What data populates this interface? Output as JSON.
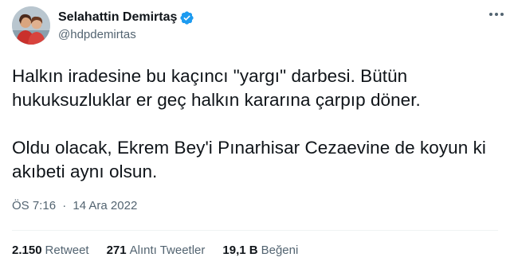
{
  "author": {
    "display_name": "Selahattin Demirtaş",
    "handle": "@hdpdemirtas",
    "verified": true
  },
  "tweet": {
    "paragraphs": [
      "Halkın iradesine bu kaçıncı \"yargı\" darbesi. Bütün hukuksuzluklar er geç halkın kararına çarpıp döner.",
      "Oldu olacak, Ekrem Bey'i Pınarhisar Cezaevine de koyun ki akıbeti aynı olsun."
    ],
    "time": "ÖS 7:16",
    "separator": "·",
    "date": "14 Ara 2022"
  },
  "stats": {
    "retweets_count": "2.150",
    "retweets_label": "Retweet",
    "quotes_count": "271",
    "quotes_label": "Alıntı Tweetler",
    "likes_count": "19,1 B",
    "likes_label": "Beğeni"
  },
  "colors": {
    "text": "#0f1419",
    "secondary": "#536471",
    "verified_badge": "#1d9bf0",
    "divider": "#eff3f4"
  },
  "icons": {
    "verified": "verified-badge-icon",
    "more": "more-options-icon"
  }
}
